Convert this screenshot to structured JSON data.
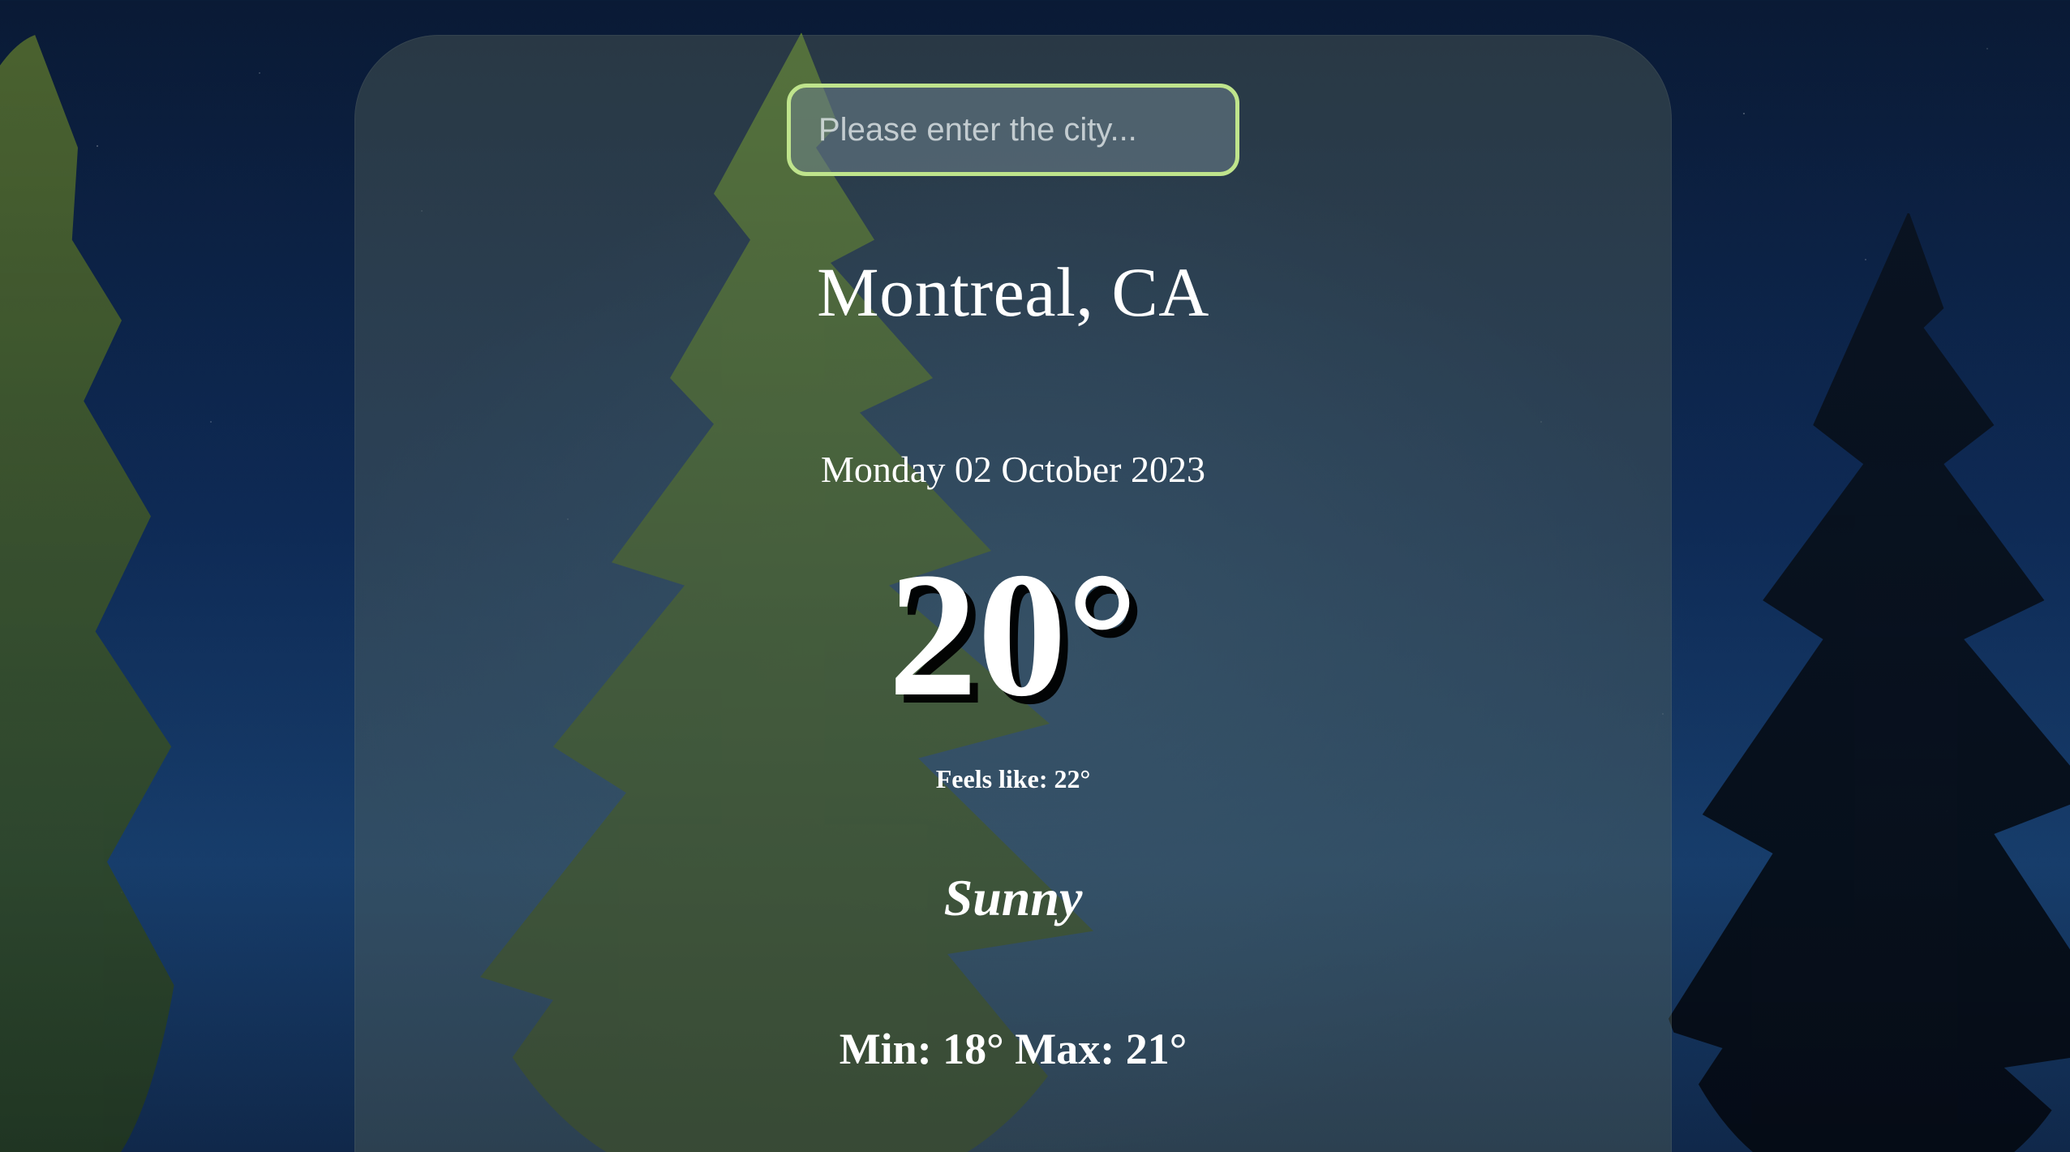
{
  "search": {
    "placeholder": "Please enter the city..."
  },
  "weather": {
    "location": "Montreal, CA",
    "date": "Monday 02 October 2023",
    "temperature": "20°",
    "feels_like": "Feels like: 22°",
    "condition": "Sunny",
    "min_max": "Min: 18° Max: 21°"
  },
  "colors": {
    "input_border": "#bfe48c",
    "text": "#ffffff"
  }
}
